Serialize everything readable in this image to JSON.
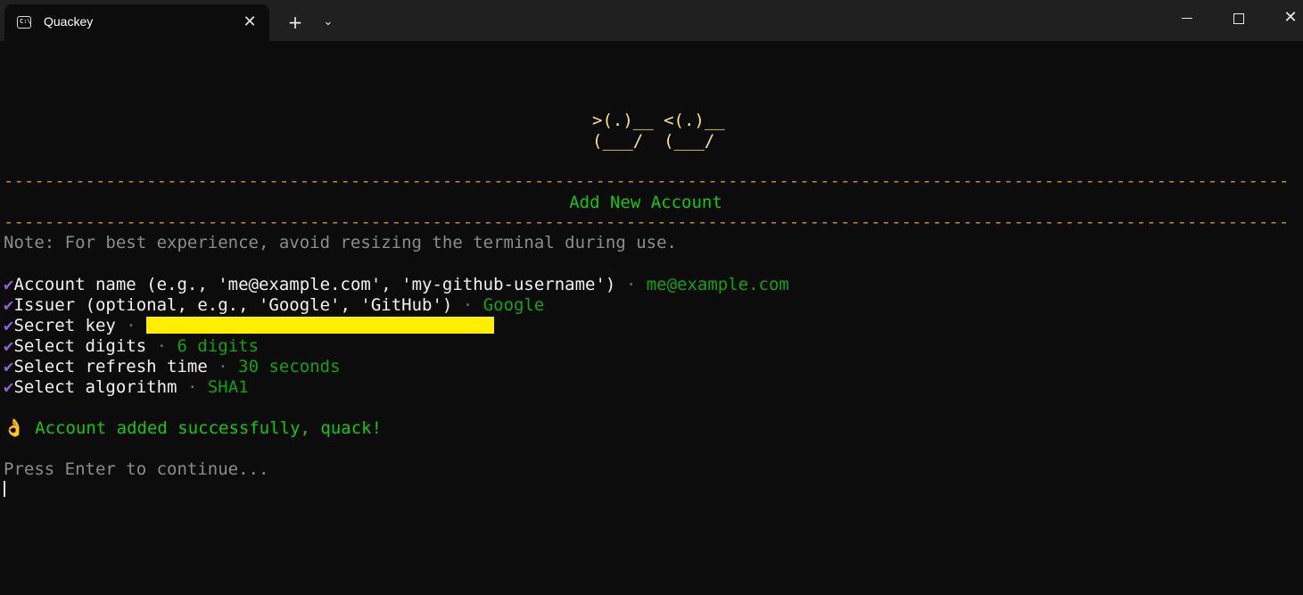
{
  "window": {
    "tab_title": "Quackey",
    "tab_icon": "terminal-icon",
    "tab_close_glyph": "✕",
    "new_tab_glyph": "+",
    "dropdown_glyph": "⌄",
    "close_glyph": "✕"
  },
  "terminal": {
    "duck_line_1": ">(.)__ <(.)__",
    "duck_line_2": "(___/  (___/",
    "rule": "----------------------------------------------------------------------------------------------------------------------------------------------------------------",
    "heading": "Add New Account",
    "note": "Note: For best experience, avoid resizing the terminal during use.",
    "check_glyph": "✔",
    "separator": "·",
    "fields": [
      {
        "prompt": "Account name (e.g., 'me@example.com', 'my-github-username')",
        "answer": "me@example.com"
      },
      {
        "prompt": "Issuer (optional, e.g., 'Google', 'GitHub')",
        "answer": "Google"
      },
      {
        "prompt": "Secret key",
        "answer": ""
      },
      {
        "prompt": "Select digits",
        "answer": "6 digits"
      },
      {
        "prompt": "Select refresh time",
        "answer": "30 seconds"
      },
      {
        "prompt": "Select algorithm",
        "answer": "SHA1"
      }
    ],
    "success_emoji": "👌",
    "success_message": "Account added successfully, quack!",
    "continue_prompt": "Press Enter to continue..."
  },
  "colors": {
    "background": "#0c0c0c",
    "duck": "#f4e68a",
    "rule": "#c48b26",
    "heading": "#16c60c",
    "answer": "#13a10e",
    "check": "#8a63d2",
    "redaction": "#ffee00"
  }
}
